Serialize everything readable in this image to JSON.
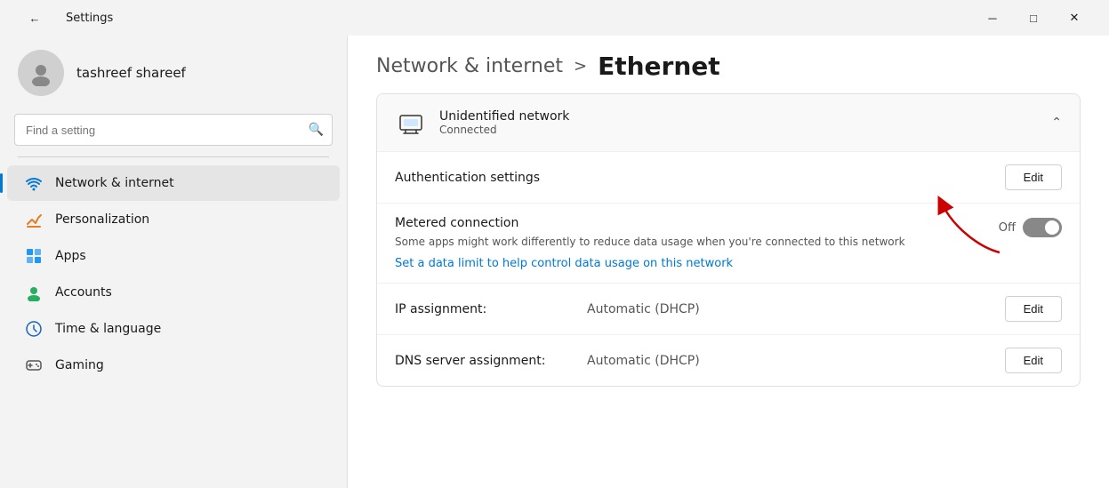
{
  "titlebar": {
    "title": "Settings",
    "back_label": "←",
    "min_label": "─",
    "max_label": "□",
    "close_label": "✕"
  },
  "sidebar": {
    "user": {
      "name": "tashreef shareef"
    },
    "search": {
      "placeholder": "Find a setting"
    },
    "items": [
      {
        "id": "network",
        "label": "Network & internet",
        "icon": "🌐",
        "active": true
      },
      {
        "id": "personalization",
        "label": "Personalization",
        "icon": "✏️",
        "active": false
      },
      {
        "id": "apps",
        "label": "Apps",
        "icon": "🧩",
        "active": false
      },
      {
        "id": "accounts",
        "label": "Accounts",
        "icon": "👤",
        "active": false
      },
      {
        "id": "time",
        "label": "Time & language",
        "icon": "🌐",
        "active": false
      },
      {
        "id": "gaming",
        "label": "Gaming",
        "icon": "🎮",
        "active": false
      }
    ]
  },
  "main": {
    "breadcrumb": {
      "parent": "Network & internet",
      "separator": ">",
      "current": "Ethernet"
    },
    "network_card": {
      "icon": "🖥",
      "name": "Unidentified network",
      "status": "Connected"
    },
    "settings": {
      "authentication": {
        "label": "Authentication settings",
        "button": "Edit"
      },
      "metered": {
        "title": "Metered connection",
        "description": "Some apps might work differently to reduce data usage when you're connected to this network",
        "link": "Set a data limit to help control data usage on this network",
        "toggle_state": "Off"
      },
      "ip_assignment": {
        "label": "IP assignment:",
        "value": "Automatic (DHCP)",
        "button": "Edit"
      },
      "dns_assignment": {
        "label": "DNS server assignment:",
        "value": "Automatic (DHCP)",
        "button": "Edit"
      }
    }
  }
}
